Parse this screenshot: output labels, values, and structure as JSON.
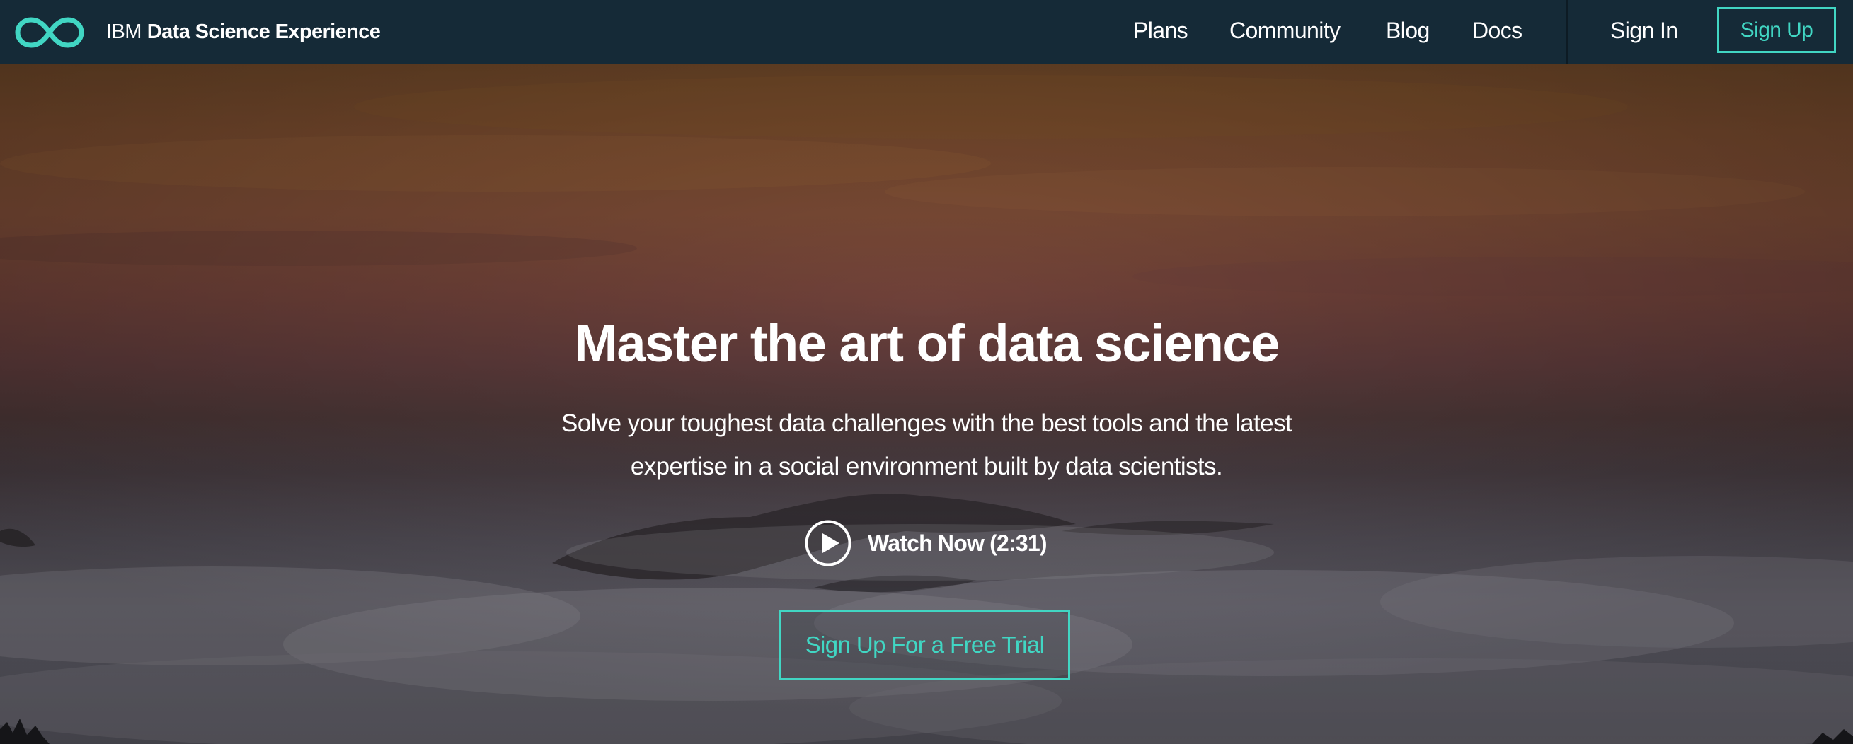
{
  "brand": {
    "logo_icon": "infinity-loop-icon",
    "company": "IBM",
    "product": "Data Science Experience"
  },
  "nav": {
    "items": [
      {
        "label": "Plans"
      },
      {
        "label": "Community"
      },
      {
        "label": "Blog"
      },
      {
        "label": "Docs"
      }
    ],
    "sign_in": "Sign In",
    "sign_up": "Sign Up"
  },
  "hero": {
    "title": "Master the art of data science",
    "subtitle_line1": "Solve your toughest data challenges with the best tools and the latest",
    "subtitle_line2": "expertise in a social environment built by data scientists.",
    "watch_icon": "play-circle-icon",
    "watch_label": "Watch Now (2:31)",
    "cta_label": "Sign Up For a Free Trial"
  },
  "colors": {
    "nav_background": "#152a37",
    "accent": "#41d6c3",
    "text": "#ffffff"
  }
}
